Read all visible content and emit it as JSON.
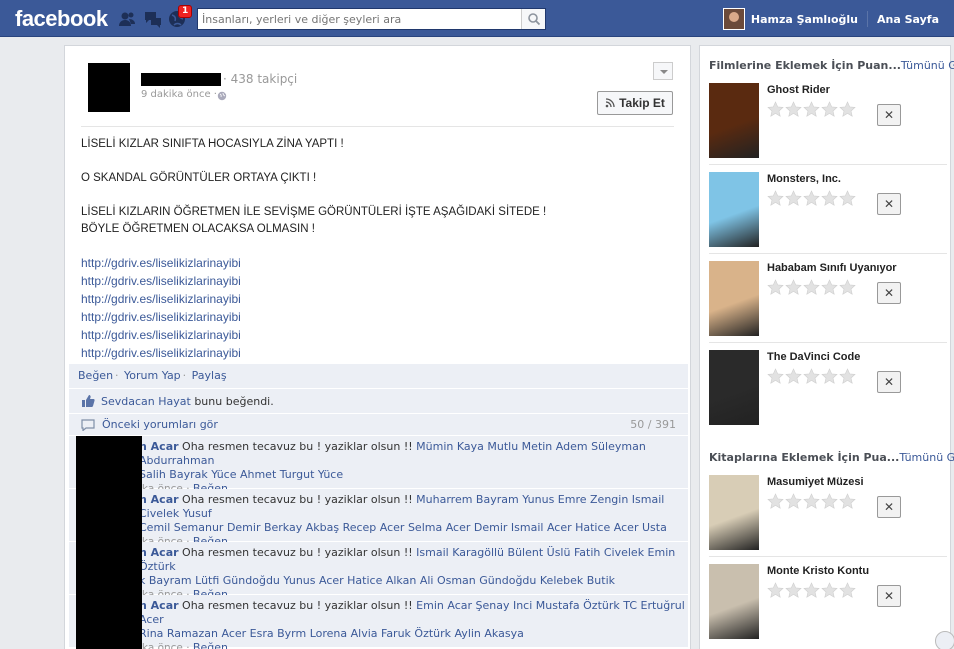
{
  "topbar": {
    "logo": "facebook",
    "notification_count": "1",
    "search_placeholder": "İnsanları, yerleri ve diğer şeyleri ara",
    "user_name": "Hamza Şamlıoğlu",
    "home_label": "Ana Sayfa"
  },
  "post": {
    "followers": "· 438 takipçi",
    "timestamp": "9 dakika önce ·",
    "follow_button": "Takip Et",
    "lines": {
      "l1": "LİSELİ KIZLAR SINIFTA HOCASIYLA ZİNA YAPTI !",
      "l2": "O SKANDAL GÖRÜNTÜLER ORTAYA ÇIKTI !",
      "l3": "LİSELİ KIZLARIN ÖĞRETMEN İLE SEVİŞME GÖRÜNTÜLERİ İŞTE AŞAĞIDAKİ SİTEDE !",
      "l4": "BÖYLE ÖĞRETMEN OLACAKSA OLMASIN !"
    },
    "links": [
      "http://gdriv.es/liselikizlarinayibi",
      "http://gdriv.es/liselikizlarinayibi",
      "http://gdriv.es/liselikizlarinayibi",
      "http://gdriv.es/liselikizlarinayibi",
      "http://gdriv.es/liselikizlarinayibi",
      "http://gdriv.es/liselikizlarinayibi"
    ]
  },
  "ufi": {
    "like": "Beğen",
    "comment": "Yorum Yap",
    "share": "Paylaş",
    "liker": "Sevdacan Hayat",
    "liked_text": " bunu beğendi.",
    "previous_comments": "Önceki yorumları gör",
    "count": "50 / 391"
  },
  "comments": [
    {
      "author": "n Acar",
      "text": " Oha resmen tecavuz bu ! yaziklar olsun !! ",
      "tags1": "Mümin Kaya Mutlu Metin Adem Süleyman Abdurrahman",
      "tags2": "Salih Bayrak Yüce Ahmet Turgut Yüce",
      "meta": "ika önce · ",
      "like": "Beğen"
    },
    {
      "author": "n Acar",
      "text": " Oha resmen tecavuz bu ! yaziklar olsun !! ",
      "tags1": "Muharrem Bayram Yunus Emre Zengin Ismail Civelek Yusuf",
      "tags2": "Cemil Semanur Demir Berkay Akbaş Recep Acer Selma Acer Demir Ismail Acer Hatice Acer Usta",
      "meta": "ika önce · ",
      "like": "Beğen"
    },
    {
      "author": "n Acar",
      "text": " Oha resmen tecavuz bu ! yaziklar olsun !! ",
      "tags1": "Ismail Karagöllü Bülent Üslü Fatih Civelek Emin Öztürk",
      "tags2": "k Bayram Lütfi Gündoğdu Yunus Acer Hatice Alkan Ali Osman Gündoğdu Kelebek Butik",
      "meta": "ika önce · ",
      "like": "Beğen"
    },
    {
      "author": "n Acar",
      "text": " Oha resmen tecavuz bu ! yaziklar olsun !! ",
      "tags1": "Emin Acar Şenay Inci Mustafa Öztürk TC Ertuğrul Acer",
      "tags2": "Rina Ramazan Acer Esra Byrm Lorena Alvia Faruk Öztürk Aylin Akasya",
      "meta": "ika önce · ",
      "like": "Beğen"
    }
  ],
  "sidebar": {
    "movies_heading": "Filmlerine Eklemek İçin Puan...",
    "see_all": "Tümünü Gör",
    "movies": [
      {
        "title": "Ghost Rider",
        "poster_color": "#5a2a10"
      },
      {
        "title": "Monsters, Inc.",
        "poster_color": "#7fc4e6"
      },
      {
        "title": "Hababam Sınıfı Uyanıyor",
        "poster_color": "#d9b38a"
      },
      {
        "title": "The DaVinci Code",
        "poster_color": "#2a2a2a"
      }
    ],
    "books_heading": "Kitaplarına Eklemek İçin Pua...",
    "books": [
      {
        "title": "Masumiyet Müzesi",
        "poster_color": "#d8cdb6"
      },
      {
        "title": "Monte Kristo Kontu",
        "poster_color": "#c9bfae"
      }
    ],
    "dismiss": "✕"
  }
}
